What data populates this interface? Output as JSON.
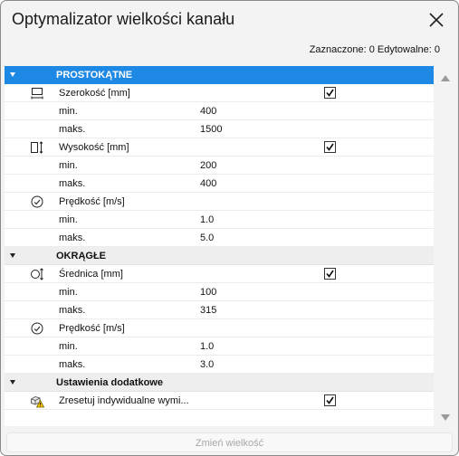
{
  "window": {
    "title": "Optymalizator wielkości kanału",
    "close_icon": "close-icon"
  },
  "status": {
    "counts": "Zaznaczone: 0 Edytowalne: 0"
  },
  "colors": {
    "selected_group": "#1e88e5",
    "group_bg": "#eeeeee",
    "checkbox": "#1a1a1a"
  },
  "groups": {
    "rect": {
      "label": "PROSTOKĄTNE",
      "expanded": true,
      "selected": true
    },
    "round": {
      "label": "OKRĄGŁE",
      "expanded": true
    },
    "extra": {
      "label": "Ustawienia dodatkowe",
      "expanded": true
    }
  },
  "rect": {
    "width": {
      "icon": "width-dimension-icon",
      "label": "Szerokość [mm]",
      "checked": true,
      "min_label": "min.",
      "min": "400",
      "max_label": "maks.",
      "max": "1500"
    },
    "height": {
      "icon": "height-dimension-icon",
      "label": "Wysokość [mm]",
      "checked": true,
      "min_label": "min.",
      "min": "200",
      "max_label": "maks.",
      "max": "400"
    },
    "speed": {
      "icon": "speedometer-icon",
      "label": "Prędkość [m/s]",
      "min_label": "min.",
      "min": "1.0",
      "max_label": "maks.",
      "max": "5.0"
    }
  },
  "round": {
    "diameter": {
      "icon": "diameter-icon",
      "label": "Średnica [mm]",
      "checked": true,
      "min_label": "min.",
      "min": "100",
      "max_label": "maks.",
      "max": "315"
    },
    "speed": {
      "icon": "speedometer-icon",
      "label": "Prędkość [m/s]",
      "min_label": "min.",
      "min": "1.0",
      "max_label": "maks.",
      "max": "3.0"
    }
  },
  "extra": {
    "reset": {
      "icon": "reset-warning-icon",
      "label": "Zresetuj indywidualne wymi...",
      "checked": true
    }
  },
  "footer": {
    "button_label": "Zmień wielkość",
    "enabled": false
  }
}
